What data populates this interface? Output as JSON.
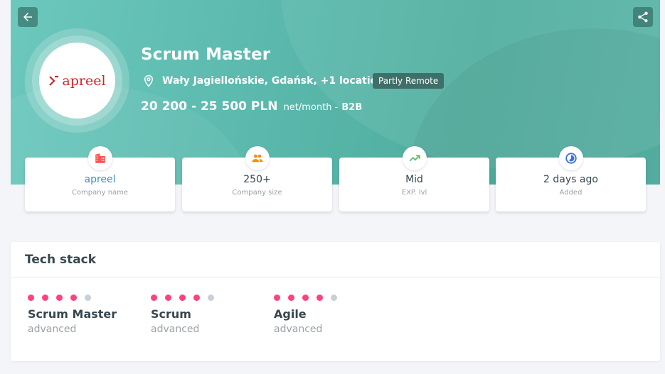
{
  "header": {
    "job_title": "Scrum Master",
    "location": "Wały Jagiellońskie, Gdańsk, +1 location",
    "remote_badge": "Partly Remote",
    "salary_amount": "20 200 - 25 500 PLN",
    "salary_period": "net/month -",
    "salary_contract": "B2B",
    "logo_text": "apreel",
    "colors": {
      "hero_bg": "#5cbaae",
      "brand": "#d0242a"
    }
  },
  "icons": {
    "back": "arrow-left-icon",
    "share": "share-icon",
    "location": "map-pin-icon",
    "dropdown": "chevron-down-icon"
  },
  "cards": [
    {
      "value": "apreel",
      "label": "Company name",
      "icon": "building-icon",
      "icon_color": "#ff5252"
    },
    {
      "value": "250+",
      "label": "Company size",
      "icon": "people-icon",
      "icon_color": "#fb8c00"
    },
    {
      "value": "Mid",
      "label": "EXP. lvl",
      "icon": "trending-up-icon",
      "icon_color": "#66bb6a"
    },
    {
      "value": "2 days ago",
      "label": "Added",
      "icon": "clock-icon",
      "icon_color": "#3d72d6"
    }
  ],
  "tech_stack": {
    "title": "Tech stack",
    "skills": [
      {
        "name": "Scrum Master",
        "level": "advanced",
        "rating": 4,
        "max": 5
      },
      {
        "name": "Scrum",
        "level": "advanced",
        "rating": 4,
        "max": 5
      },
      {
        "name": "Agile",
        "level": "advanced",
        "rating": 4,
        "max": 5
      }
    ],
    "colors": {
      "dot_on": "#ff4081",
      "dot_off": "#c9cfd8"
    }
  }
}
